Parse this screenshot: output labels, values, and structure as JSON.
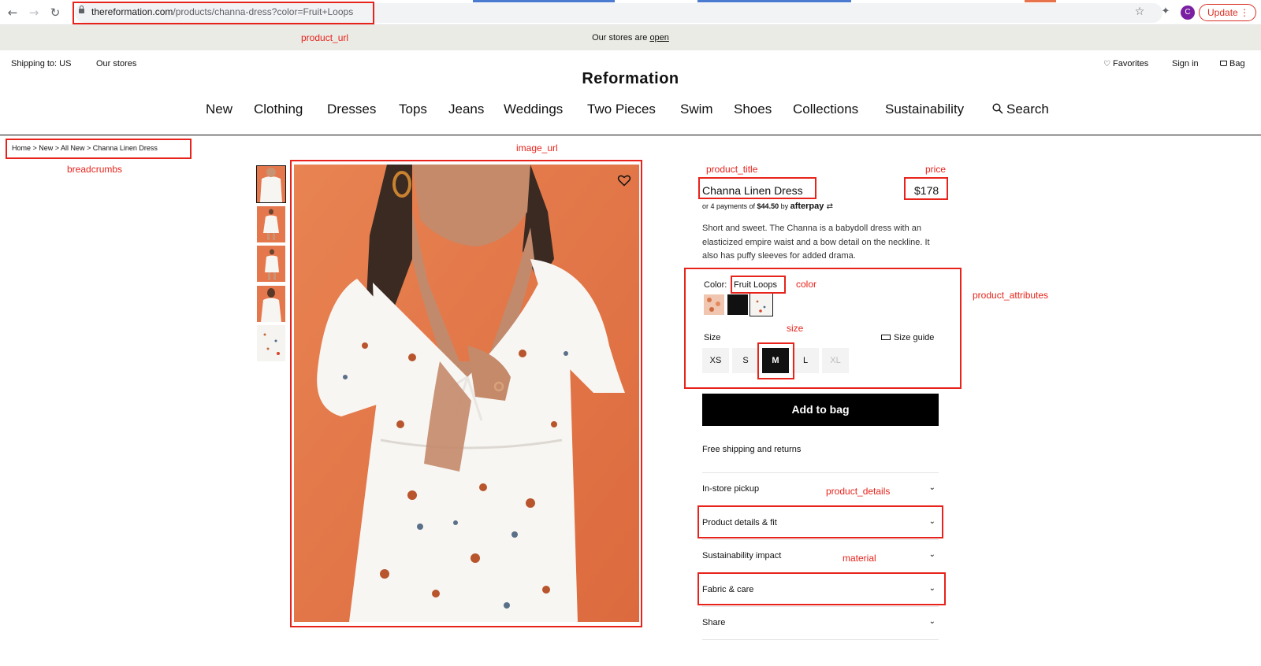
{
  "browser": {
    "url_host": "thereformation.com",
    "url_path": "/products/channa-dress?color=Fruit+Loops",
    "profile_initial": "C",
    "update_label": "Update",
    "icons": [
      "back-icon",
      "forward-icon",
      "reload-icon",
      "lock-icon",
      "star-icon",
      "extensions-icon",
      "menu-icon"
    ]
  },
  "announcement": {
    "text": "Our stores are ",
    "link": "open"
  },
  "utility": {
    "shipping": "Shipping to: US",
    "stores": "Our stores",
    "favorites": "Favorites",
    "sign_in": "Sign in",
    "bag": "Bag"
  },
  "brand": "Reformation",
  "nav": [
    "New",
    "Clothing",
    "Dresses",
    "Tops",
    "Jeans",
    "Weddings",
    "Two Pieces",
    "Swim",
    "Shoes",
    "Collections",
    "Sustainability",
    "Search"
  ],
  "breadcrumbs": "Home > New > All New > Channa Linen Dress",
  "product": {
    "title": "Channa Linen Dress",
    "price": "$178",
    "afterpay_prefix": "or 4 payments of ",
    "afterpay_amount": "$44.50",
    "afterpay_by": " by ",
    "afterpay_brand": "afterpay",
    "description": "Short and sweet. The Channa is a babydoll dress with an elasticized empire waist and a bow detail on the neckline. It also has puffy sleeves for added drama.",
    "color_label": "Color:",
    "color_value": "Fruit Loops",
    "size_label": "Size",
    "size_guide": "Size guide",
    "sizes": [
      "XS",
      "S",
      "M",
      "L",
      "XL"
    ],
    "selected_size": "M",
    "unavailable_sizes": [
      "XL"
    ],
    "add_to_bag": "Add to bag",
    "shipping_note": "Free shipping and returns",
    "accordions": [
      "In-store pickup",
      "Product details & fit",
      "Sustainability impact",
      "Fabric & care",
      "Share"
    ]
  },
  "annotations": {
    "product_url": "product_url",
    "breadcrumbs": "breadcrumbs",
    "image_url": "image_url",
    "product_title": "product_title",
    "price": "price",
    "color": "color",
    "product_attributes": "product_attributes",
    "size": "size",
    "product_details": "product_details",
    "material": "material"
  },
  "colors": {
    "annotation": "#e8231b",
    "announcement_bg": "#ebebe6",
    "photo_background": "#e5774d",
    "button_bg": "#000000"
  }
}
